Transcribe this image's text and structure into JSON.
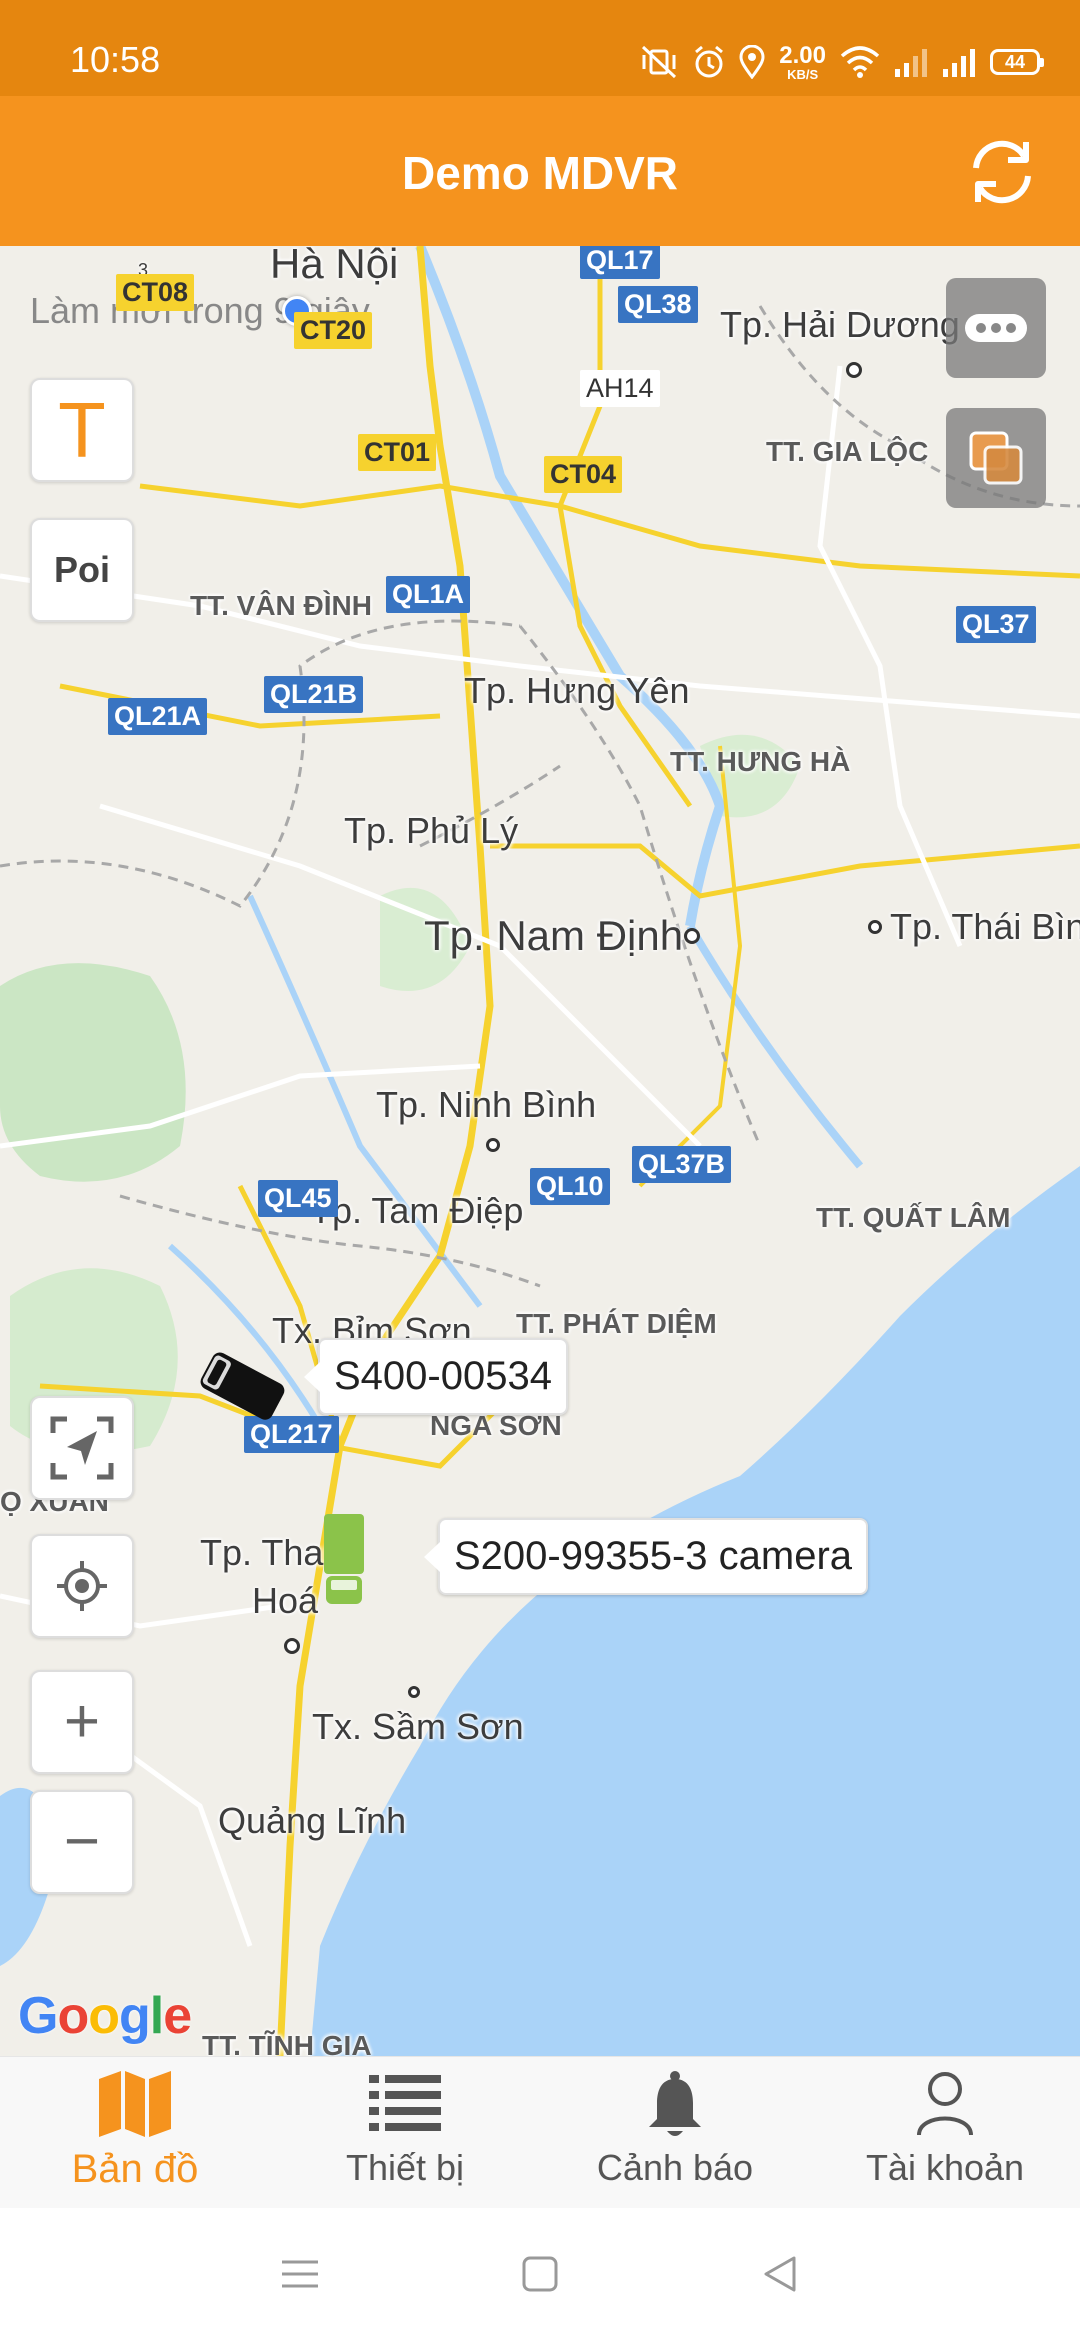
{
  "status_bar": {
    "time": "10:58",
    "net_speed_value": "2.00",
    "net_speed_unit": "KB/S",
    "battery": "44",
    "icons": [
      "mute-vibrate-icon",
      "alarm-icon",
      "location-icon",
      "wifi-icon",
      "signal-icon",
      "signal-icon",
      "battery-icon"
    ]
  },
  "app_bar": {
    "title": "Demo MDVR",
    "refresh_icon": "refresh-icon"
  },
  "map": {
    "refresh_note": "Làm mới trong 9 giây",
    "stray_number": "3",
    "controls": {
      "text_button": "T",
      "poi_button": "Poi",
      "zoom_in": "+",
      "zoom_out": "−",
      "layers_icon": "layers-icon",
      "more_icon": "more-icon",
      "fit_icon": "fit-bounds-icon",
      "locate_icon": "my-location-icon"
    },
    "places": {
      "ha_noi": "Hà Nội",
      "hai_duong": "Tp. Hải Dương",
      "gia_loc": "TT. GIA LỘC",
      "van_dinh": "TT. VÂN ĐÌNH",
      "hung_yen": "Tp. Hưng Yên",
      "hung_ha": "TT. HƯNG HÀ",
      "phu_ly": "Tp. Phủ Lý",
      "nam_dinh": "Tp. Nam Định",
      "thai_binh": "Tp. Thái Bìn",
      "ninh_binh": "Tp. Ninh Bình",
      "quat_lam": "TT. QUẤT LÂM",
      "tam_diep": "Tp. Tam Điệp",
      "bim_son": "Tx. Bỉm Sơn",
      "phat_diem": "TT. PHÁT DIỆM",
      "nga_son": "NGA SƠN",
      "ngoc_xuan": "Ọ XUÂN",
      "thanh_hoa_1": "Tp. Thanh",
      "thanh_hoa_2": "Hoá",
      "sam_son": "Tx. Sầm Sơn",
      "quang_linh": "Quảng Lĩnh",
      "tinh_gia": "TT. TĨNH GIA"
    },
    "roads": {
      "ct08": "CT08",
      "ct20": "CT20",
      "ql17": "QL17",
      "ql38": "QL38",
      "ah14": "AH14",
      "ct01": "CT01",
      "ct04": "CT04",
      "ql1a": "QL1A",
      "ql37": "QL37",
      "ql21b": "QL21B",
      "ql21a": "QL21A",
      "ql45": "QL45",
      "ql10": "QL10",
      "ql37b": "QL37B",
      "ql217": "QL217"
    },
    "vehicles": [
      {
        "label": "S400-00534",
        "color": "#111111"
      },
      {
        "label": "S200-99355-3 camera",
        "color": "#8BC34A"
      }
    ],
    "google_logo": "Google"
  },
  "bottom_nav": {
    "items": [
      {
        "label": "Bản đồ",
        "icon": "map-icon",
        "active": true
      },
      {
        "label": "Thiết bị",
        "icon": "list-icon",
        "active": false
      },
      {
        "label": "Cảnh báo",
        "icon": "bell-icon",
        "active": false
      },
      {
        "label": "Tài khoản",
        "icon": "user-icon",
        "active": false
      }
    ]
  },
  "system_nav": {
    "icons": [
      "menu-icon",
      "home-icon",
      "back-icon"
    ]
  },
  "colors": {
    "status_bar": "#E5860F",
    "app_bar": "#F5931E",
    "accent": "#F5931E",
    "water": "#AAD3F8",
    "road_badge": "#3874C2",
    "provincial_badge": "#F6D22E"
  }
}
